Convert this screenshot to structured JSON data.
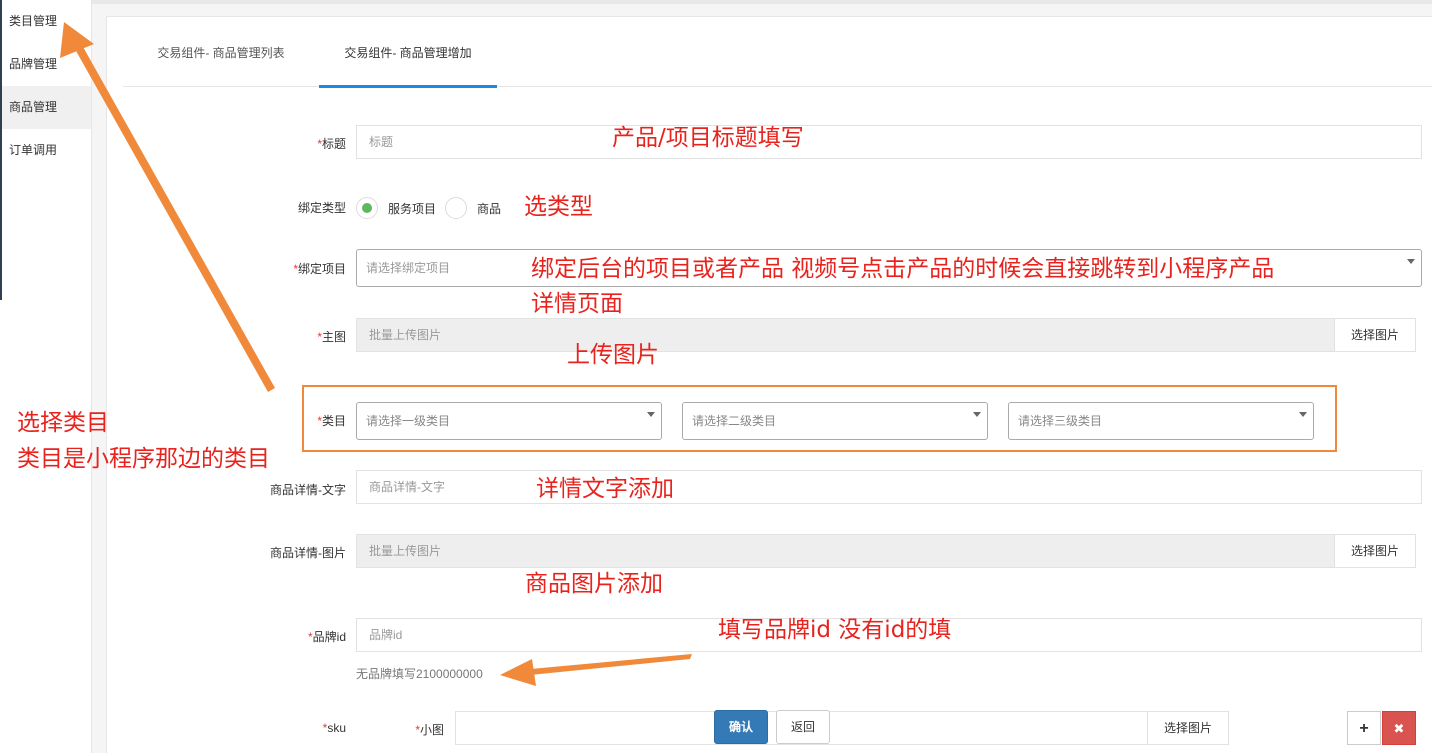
{
  "sidebar": {
    "items": [
      {
        "label": "类目管理"
      },
      {
        "label": "品牌管理"
      },
      {
        "label": "商品管理"
      },
      {
        "label": "订单调用"
      }
    ]
  },
  "tabs": [
    {
      "label": "交易组件- 商品管理列表"
    },
    {
      "label": "交易组件- 商品管理增加"
    }
  ],
  "form": {
    "required_mark": "*",
    "title": {
      "label": "标题",
      "placeholder": "标题"
    },
    "bind_type": {
      "label": "绑定类型",
      "options": [
        "服务项目",
        "商品"
      ],
      "selected": "服务项目"
    },
    "bind_item": {
      "label": "绑定项目",
      "placeholder": "请选择绑定项目"
    },
    "main_image": {
      "label": "主图",
      "placeholder": "批量上传图片",
      "button": "选择图片"
    },
    "category": {
      "label": "类目",
      "level1": "请选择一级类目",
      "level2": "请选择二级类目",
      "level3": "请选择三级类目"
    },
    "detail_text": {
      "label": "商品详情-文字",
      "placeholder": "商品详情-文字"
    },
    "detail_image": {
      "label": "商品详情-图片",
      "placeholder": "批量上传图片",
      "button": "选择图片"
    },
    "brand_id": {
      "label": "品牌id",
      "placeholder": "品牌id",
      "hint": "无品牌填写2100000000"
    },
    "sku": {
      "label": "sku",
      "small_image_label": "小图",
      "confirm": "确认",
      "back": "返回",
      "pick": "选择图片",
      "add": "+",
      "remove": "✖"
    }
  },
  "annotations": {
    "title_note": "产品/项目标题填写",
    "type_note": "选类型",
    "bind_note_line1": "绑定后台的项目或者产品  视频号点击产品的时候会直接跳转到小程序产品",
    "bind_note_line2": "详情页面",
    "upload_note": "上传图片",
    "category_note_line1": "选择类目",
    "category_note_line2": "类目是小程序那边的类目",
    "detail_text_note": "详情文字添加",
    "detail_image_note": "商品图片添加",
    "brand_note": "填写品牌id  没有id的填"
  },
  "colors": {
    "accent_blue": "#1e88e5",
    "annotation_red": "#e8231d",
    "annotation_orange": "#f0893a",
    "radio_green": "#5cb85c",
    "primary_button": "#337ab7",
    "danger_button": "#d9534f"
  }
}
